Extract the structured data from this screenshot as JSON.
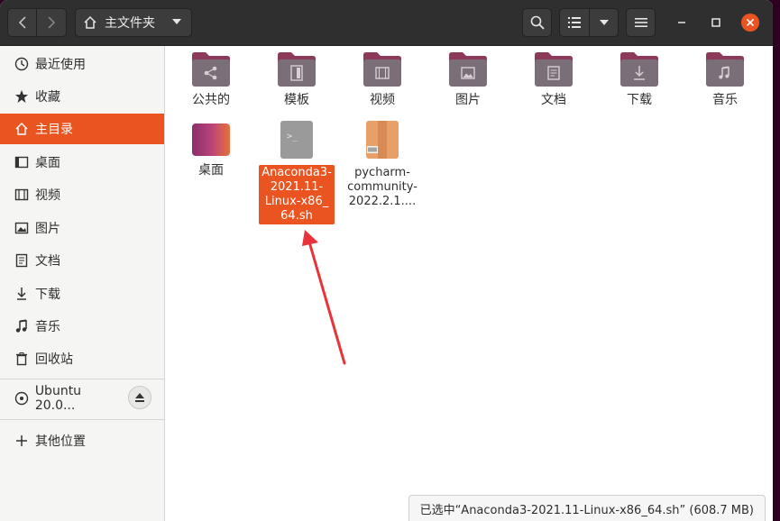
{
  "header": {
    "path_label": "主文件夹"
  },
  "sidebar": {
    "items": [
      {
        "label": "最近使用",
        "icon": "recent-icon"
      },
      {
        "label": "收藏",
        "icon": "star-icon"
      },
      {
        "label": "主目录",
        "icon": "home-icon"
      },
      {
        "label": "桌面",
        "icon": "desktop-icon"
      },
      {
        "label": "视频",
        "icon": "video-icon"
      },
      {
        "label": "图片",
        "icon": "picture-icon"
      },
      {
        "label": "文档",
        "icon": "document-icon"
      },
      {
        "label": "下载",
        "icon": "download-icon"
      },
      {
        "label": "音乐",
        "icon": "music-icon"
      },
      {
        "label": "回收站",
        "icon": "trash-icon"
      }
    ],
    "device": {
      "label": "Ubuntu 20.0...",
      "icon": "disc-icon"
    },
    "other": {
      "label": "其他位置",
      "icon": "plus-icon"
    }
  },
  "files": [
    {
      "name": "公共的",
      "type": "folder",
      "emblem": "share-icon"
    },
    {
      "name": "模板",
      "type": "folder",
      "emblem": "template-icon"
    },
    {
      "name": "视频",
      "type": "folder",
      "emblem": "video-icon"
    },
    {
      "name": "图片",
      "type": "folder",
      "emblem": "picture-icon"
    },
    {
      "name": "文档",
      "type": "folder",
      "emblem": "document-icon"
    },
    {
      "name": "下载",
      "type": "folder",
      "emblem": "download-icon"
    },
    {
      "name": "音乐",
      "type": "folder",
      "emblem": "music-icon"
    },
    {
      "name": "桌面",
      "type": "folder",
      "emblem": "desktop-icon"
    },
    {
      "name": "Anaconda3-2021.11-Linux-x86_64.sh",
      "display": "Anaconda3-\n2021.11-\nLinux-x86_\n64.sh",
      "type": "shell-script",
      "selected": true
    },
    {
      "name": "pycharm-community-2022.2.1....",
      "display": "pycharm-\ncommunity-\n2022.2.1....",
      "type": "archive"
    }
  ],
  "status": {
    "text": "已选中“Anaconda3-2021.11-Linux-x86_64.sh” (608.7 MB)"
  },
  "colors": {
    "accent": "#e95420",
    "headerbar": "#2f2f2f",
    "folder_top": "#8b3a5a",
    "folder_body": "#7a6f78",
    "annotation_arrow": "#e8333a"
  }
}
